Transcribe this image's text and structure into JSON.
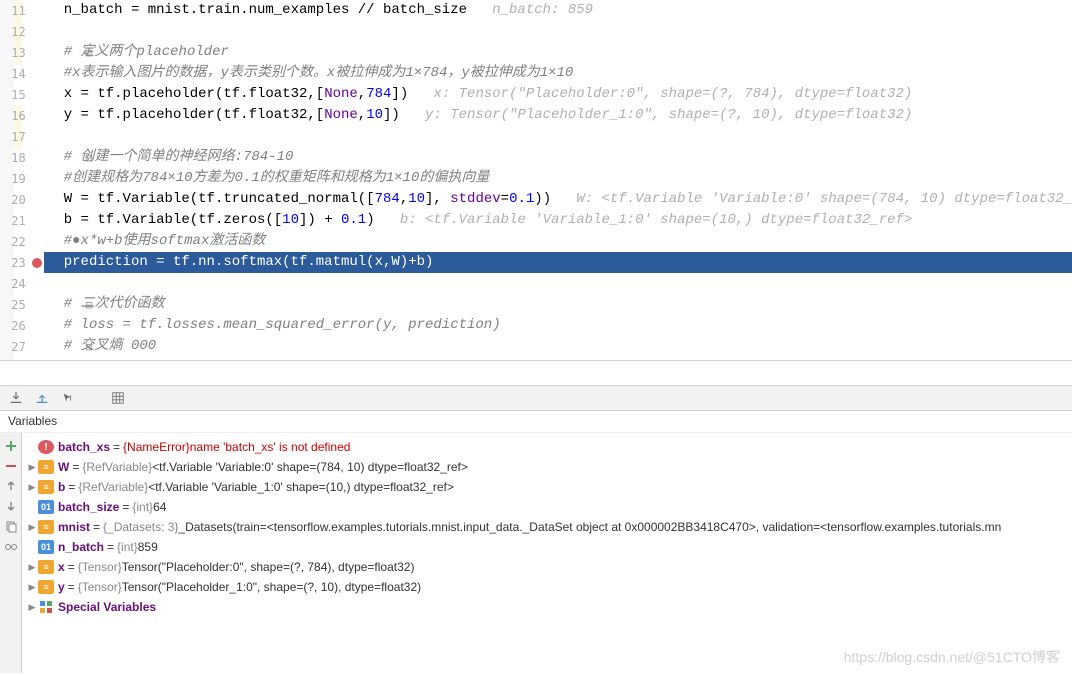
{
  "editor": {
    "lines": [
      {
        "n": 11,
        "seg": [
          {
            "t": "n_batch = mnist.train.num_examples // batch_size   ",
            "c": ""
          },
          {
            "t": "n_batch: 859",
            "c": "hint"
          }
        ]
      },
      {
        "n": 12,
        "seg": []
      },
      {
        "n": 13,
        "fold": "⊟",
        "seg": [
          {
            "t": "# 定义两个placeholder",
            "c": "cmt"
          }
        ]
      },
      {
        "n": 14,
        "seg": [
          {
            "t": "#x表示输入图片的数据，y表示类别个数。x被拉伸成为1×784，y被拉伸成为1×10",
            "c": "cmt"
          }
        ]
      },
      {
        "n": 15,
        "seg": [
          {
            "t": "x = tf.placeholder(tf.float32,[",
            "c": ""
          },
          {
            "t": "None",
            "c": "arg"
          },
          {
            "t": ",",
            "c": ""
          },
          {
            "t": "784",
            "c": "num"
          },
          {
            "t": "])   ",
            "c": ""
          },
          {
            "t": "x: Tensor(\"Placeholder:0\", shape=(?, 784), dtype=float32)",
            "c": "hint"
          }
        ]
      },
      {
        "n": 16,
        "seg": [
          {
            "t": "y = tf.placeholder(tf.float32,[",
            "c": ""
          },
          {
            "t": "None",
            "c": "arg"
          },
          {
            "t": ",",
            "c": ""
          },
          {
            "t": "10",
            "c": "num"
          },
          {
            "t": "])   ",
            "c": ""
          },
          {
            "t": "y: Tensor(\"Placeholder_1:0\", shape=(?, 10), dtype=float32)",
            "c": "hint"
          }
        ]
      },
      {
        "n": 17,
        "seg": []
      },
      {
        "n": 18,
        "fold": "⊟",
        "seg": [
          {
            "t": "# 创建一个简单的神经网络:784-10",
            "c": "cmt"
          }
        ]
      },
      {
        "n": 19,
        "seg": [
          {
            "t": "#创建规格为784×10方差为0.1的权重矩阵和规格为1×10的偏执向量",
            "c": "cmt"
          }
        ]
      },
      {
        "n": 20,
        "seg": [
          {
            "t": "W = tf.Variable(tf.truncated_normal([",
            "c": ""
          },
          {
            "t": "784",
            "c": "num"
          },
          {
            "t": ",",
            "c": ""
          },
          {
            "t": "10",
            "c": "num"
          },
          {
            "t": "], ",
            "c": ""
          },
          {
            "t": "stddev",
            "c": "arg"
          },
          {
            "t": "=",
            "c": ""
          },
          {
            "t": "0.1",
            "c": "num"
          },
          {
            "t": "))   ",
            "c": ""
          },
          {
            "t": "W: <tf.Variable 'Variable:0' shape=(784, 10) dtype=float32_",
            "c": "hint"
          }
        ]
      },
      {
        "n": 21,
        "seg": [
          {
            "t": "b = tf.Variable(tf.zeros([",
            "c": ""
          },
          {
            "t": "10",
            "c": "num"
          },
          {
            "t": "]) + ",
            "c": ""
          },
          {
            "t": "0.1",
            "c": "num"
          },
          {
            "t": ")   ",
            "c": ""
          },
          {
            "t": "b: <tf.Variable 'Variable_1:0' shape=(10,) dtype=float32_ref>",
            "c": "hint"
          }
        ]
      },
      {
        "n": 22,
        "seg": [
          {
            "t": "#●x*w+b使用softmax激活函数",
            "c": "cmt"
          }
        ]
      },
      {
        "n": 23,
        "bp": true,
        "hl": true,
        "seg": [
          {
            "t": "prediction = tf.nn.softmax(tf.matmul(x,W)+b)",
            "c": ""
          }
        ]
      },
      {
        "n": 24,
        "seg": []
      },
      {
        "n": 25,
        "fold": "⊟",
        "seg": [
          {
            "t": "# 二次代价函数",
            "c": "cmt"
          }
        ]
      },
      {
        "n": 26,
        "seg": [
          {
            "t": "# loss = tf.losses.mean_squared_error(y, prediction)",
            "c": "cmt"
          }
        ]
      },
      {
        "n": 27,
        "fold": "⊟",
        "seg": [
          {
            "t": "# 交叉熵 000",
            "c": "cmt"
          }
        ]
      }
    ]
  },
  "variables_title": "Variables",
  "variables": [
    {
      "exp": "",
      "icon": "err",
      "iconTxt": "!",
      "name": "batch_xs",
      "type": "",
      "val": "{NameError}name 'batch_xs' is not defined",
      "valClass": "verr"
    },
    {
      "exp": "▶",
      "icon": "obj",
      "iconTxt": "≡",
      "name": "W",
      "type": "{RefVariable}",
      "val": "<tf.Variable 'Variable:0' shape=(784, 10) dtype=float32_ref>"
    },
    {
      "exp": "▶",
      "icon": "obj",
      "iconTxt": "≡",
      "name": "b",
      "type": "{RefVariable}",
      "val": "<tf.Variable 'Variable_1:0' shape=(10,) dtype=float32_ref>"
    },
    {
      "exp": "",
      "icon": "int",
      "iconTxt": "01",
      "name": "batch_size",
      "type": "{int}",
      "val": "64"
    },
    {
      "exp": "▶",
      "icon": "obj",
      "iconTxt": "≡",
      "name": "mnist",
      "type": "{_Datasets: 3}",
      "val": "_Datasets(train=<tensorflow.examples.tutorials.mnist.input_data._DataSet object at 0x000002BB3418C470>, validation=<tensorflow.examples.tutorials.mn"
    },
    {
      "exp": "",
      "icon": "int",
      "iconTxt": "01",
      "name": "n_batch",
      "type": "{int}",
      "val": "859"
    },
    {
      "exp": "▶",
      "icon": "obj",
      "iconTxt": "≡",
      "name": "x",
      "type": "{Tensor}",
      "val": "Tensor(\"Placeholder:0\", shape=(?, 784), dtype=float32)"
    },
    {
      "exp": "▶",
      "icon": "obj",
      "iconTxt": "≡",
      "name": "y",
      "type": "{Tensor}",
      "val": "Tensor(\"Placeholder_1:0\", shape=(?, 10), dtype=float32)"
    },
    {
      "exp": "▶",
      "icon": "sp",
      "iconTxt": "",
      "name": "Special Variables",
      "type": "",
      "val": ""
    }
  ],
  "watermark": "https://blog.csdn.net/@51CTO博客"
}
